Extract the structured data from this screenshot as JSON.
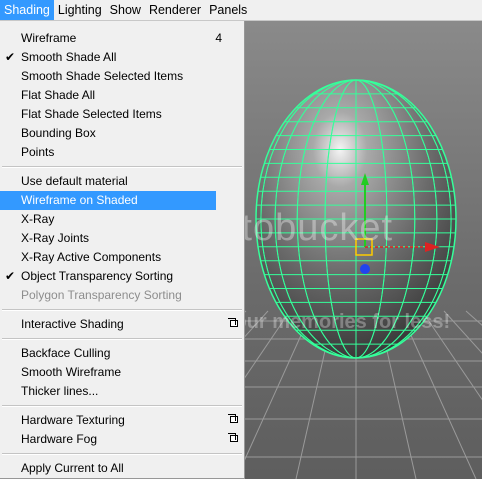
{
  "menubar": {
    "items": [
      "Shading",
      "Lighting",
      "Show",
      "Renderer",
      "Panels"
    ]
  },
  "menu": {
    "wireframe": {
      "label": "Wireframe",
      "shortcut": "4"
    },
    "smooth_shade_all": {
      "label": "Smooth Shade All",
      "check": "✔"
    },
    "smooth_shade_selected": {
      "label": "Smooth Shade Selected Items"
    },
    "flat_shade_all": {
      "label": "Flat Shade All"
    },
    "flat_shade_selected": {
      "label": "Flat Shade Selected Items"
    },
    "bounding_box": {
      "label": "Bounding Box"
    },
    "points": {
      "label": "Points"
    },
    "use_default_material": {
      "label": "Use default material"
    },
    "wireframe_on_shaded": {
      "label": "Wireframe on Shaded"
    },
    "xray": {
      "label": "X-Ray"
    },
    "xray_joints": {
      "label": "X-Ray Joints"
    },
    "xray_active_components": {
      "label": "X-Ray Active Components"
    },
    "object_transparency_sorting": {
      "label": "Object Transparency Sorting",
      "check": "✔"
    },
    "polygon_transparency_sorting": {
      "label": "Polygon Transparency Sorting"
    },
    "interactive_shading": {
      "label": "Interactive Shading"
    },
    "backface_culling": {
      "label": "Backface Culling"
    },
    "smooth_wireframe": {
      "label": "Smooth Wireframe"
    },
    "thicker_lines": {
      "label": "Thicker lines..."
    },
    "hardware_texturing": {
      "label": "Hardware Texturing"
    },
    "hardware_fog": {
      "label": "Hardware Fog"
    },
    "apply_current_to_all": {
      "label": "Apply Current to All"
    }
  },
  "watermark": {
    "brand": "photobucket",
    "tagline": "Protect more of your memories for less!"
  },
  "colors": {
    "menu_highlight": "#3399ff",
    "wireframe": "#35ff9a",
    "manipulator_y": "#22cc22",
    "manipulator_x": "#dd2222",
    "manipulator_z": "#2244ee",
    "pivot": "#ffcc00"
  },
  "icons": {
    "option_box": "option-box-icon",
    "check": "checkmark-icon"
  }
}
